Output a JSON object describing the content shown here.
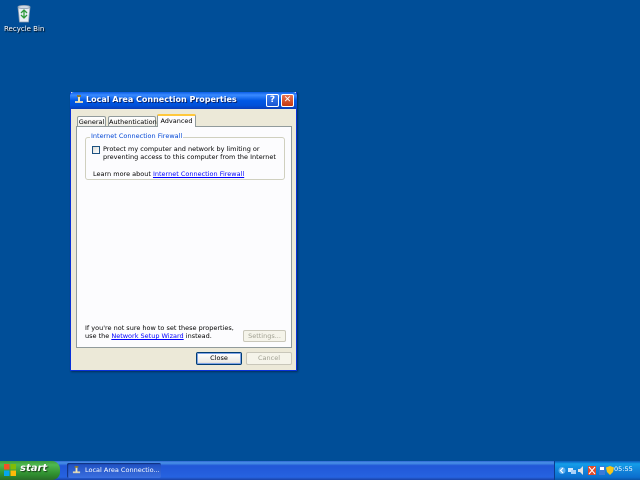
{
  "desktop": {
    "background_color": "#004e98",
    "icons": [
      {
        "label": "Recycle Bin",
        "icon": "recycle-bin-icon"
      }
    ]
  },
  "window": {
    "title": "Local Area Connection Properties",
    "title_icon": "network-connection-icon",
    "help_button_glyph": "?",
    "close_button_glyph": "✕",
    "tabs": [
      {
        "label": "General",
        "active": false
      },
      {
        "label": "Authentication",
        "active": false
      },
      {
        "label": "Advanced",
        "active": true
      }
    ],
    "firewall_group": {
      "legend": "Internet Connection Firewall",
      "checkbox_label": "Protect my computer and network by limiting or preventing access to this computer from the Internet",
      "checkbox_checked": false,
      "learn_more_prefix": "Learn more about",
      "learn_more_link": "Internet Connection Firewall"
    },
    "hint_text_prefix": "If you're not sure how to set these properties, use the",
    "hint_link": "Network Setup Wizard",
    "hint_text_suffix": "instead.",
    "settings_button": "Settings...",
    "close_button": "Close",
    "cancel_button": "Cancel"
  },
  "taskbar": {
    "start_label": "start",
    "tasks": [
      {
        "label": "Local Area Connectio...",
        "icon": "network-connection-icon"
      }
    ],
    "tray_icons": [
      "arrow-left-icon",
      "network-icon",
      "volume-icon",
      "security-icon",
      "update-icon",
      "shield-icon"
    ],
    "clock": "05:55"
  },
  "colors": {
    "titlebar": "#0058e6",
    "taskbar": "#2663e0",
    "start_button": "#3c9c3c",
    "link": "#0000ff",
    "group_legend": "#0046d5"
  }
}
